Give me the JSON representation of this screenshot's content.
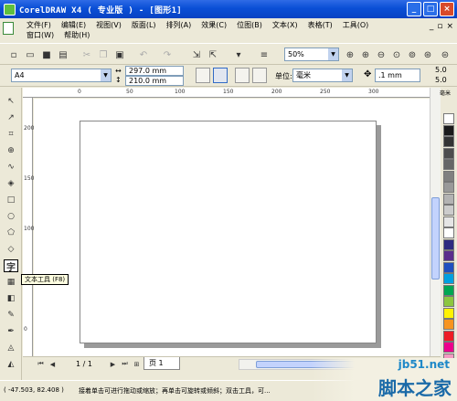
{
  "window": {
    "title": "CorelDRAW X4 ( 专业版 ) - [图形1]",
    "controls": {
      "minimize": "_",
      "maximize": "□",
      "close": "×"
    }
  },
  "menu": {
    "row1": [
      "文件(F)",
      "编辑(E)",
      "视图(V)",
      "版面(L)",
      "排列(A)",
      "效果(C)",
      "位图(B)",
      "文本(X)",
      "表格(T)",
      "工具(O)"
    ],
    "row2": [
      "窗口(W)",
      "帮助(H)"
    ],
    "mdi": {
      "minimize": "_",
      "restore": "▫",
      "close": "×"
    }
  },
  "toolbar": {
    "zoom_value": "50%"
  },
  "property_bar": {
    "paper_size": "A4",
    "width": "297.0 mm",
    "height": "210.0 mm",
    "units_label": "单位:",
    "units_value": "毫米",
    "nudge_value": ".1 mm",
    "dup_x": "5.0",
    "dup_y": "5.0"
  },
  "ruler": {
    "top_ticks": [
      "0",
      "50",
      "100",
      "150",
      "200",
      "250",
      "300"
    ],
    "left_ticks": [
      "200",
      "150",
      "100",
      "50",
      "0"
    ],
    "unit": "毫米"
  },
  "tooltip": "文本工具 (F8)",
  "page_nav": {
    "counter": "1 / 1",
    "tab": "页 1"
  },
  "status": {
    "coordinates": "( -47.503, 82.408 )",
    "message": "接着单击可进行拖动或缩放；再单击可旋转或倾斜；双击工具，可..."
  },
  "watermark": {
    "line1": "jb51.net",
    "line2": "脚本之家"
  },
  "palette_colors": [
    "#ffffff",
    "#1a1a1a",
    "#333333",
    "#4d4d4d",
    "#666666",
    "#808080",
    "#999999",
    "#b3b3b3",
    "#cccccc",
    "#e5e5e5",
    "#ffffff",
    "#2e2a80",
    "#5a2d8c",
    "#1f4fbf",
    "#00a0e0",
    "#00a651",
    "#8dc63f",
    "#fff200",
    "#f7941d",
    "#ed1c24",
    "#ec008c",
    "#f49ac1",
    "#c69c6d"
  ]
}
